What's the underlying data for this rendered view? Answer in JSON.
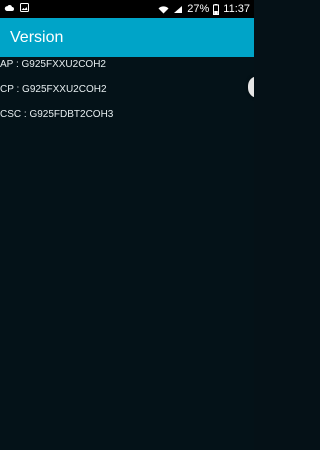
{
  "status_bar": {
    "battery_text": "27%",
    "time": "11:37",
    "icons": {
      "left": [
        "cloud-icon",
        "image-icon"
      ],
      "right": [
        "wifi-icon",
        "signal-icon",
        "battery-icon"
      ]
    }
  },
  "header": {
    "title": "Version",
    "accent": "#00a4c8"
  },
  "versions": [
    {
      "label": "AP : G925FXXU2COH2"
    },
    {
      "label": "CP : G925FXXU2COH2"
    },
    {
      "label": "CSC : G925FDBT2COH3"
    }
  ],
  "colors": {
    "background": "#041218",
    "status_bar": "#000000",
    "text": "#e7eef0"
  }
}
